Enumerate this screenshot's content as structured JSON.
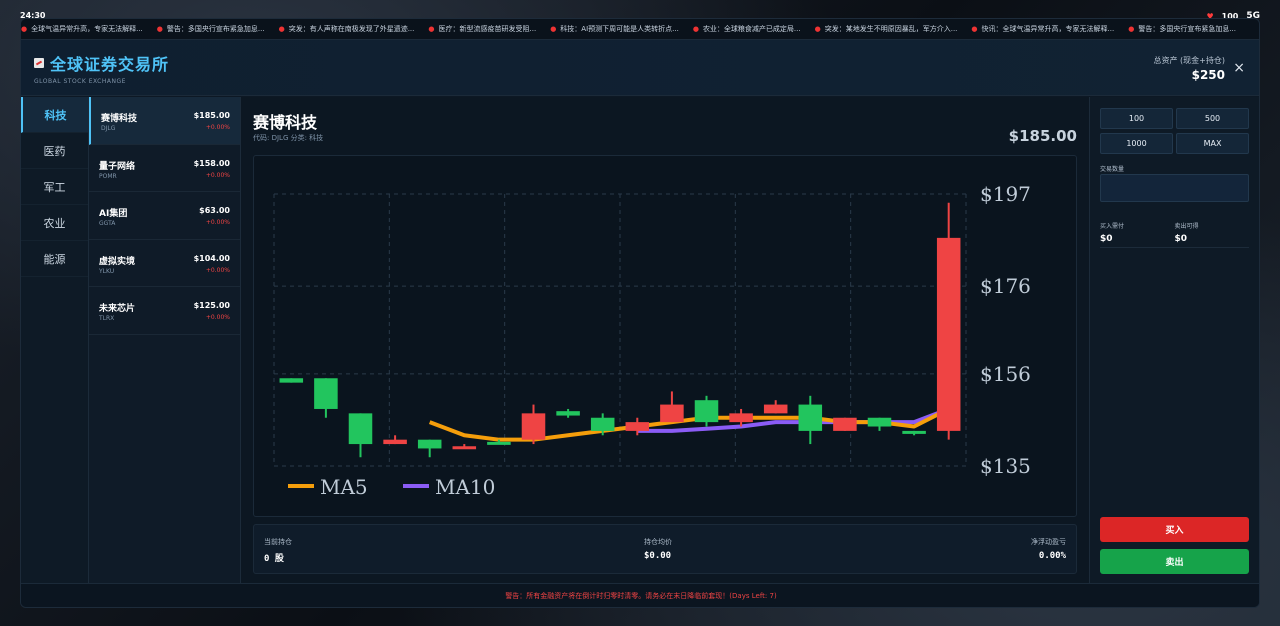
{
  "status_bar": {
    "time": "24:30",
    "health": "100",
    "network": "5G"
  },
  "ticker": [
    "全球气温异常升高，专家无法解释...",
    "警告：多国央行宣布紧急加息...",
    "突发：有人声称在南极发现了外星遗迹...",
    "医疗：新型流感疫苗研发受阻...",
    "科技：AI预测下周可能是人类转折点...",
    "农业：全球粮食减产已成定局...",
    "突发：某地发生不明原因暴乱，军方介入...",
    "快讯：全球气温异常升高，专家无法解释...",
    "警告：多国央行宣布紧急加息..."
  ],
  "header": {
    "title": "全球证券交易所",
    "subtitle": "GLOBAL STOCK EXCHANGE",
    "assets_label": "总资产 (现金+持仓)",
    "assets_value": "$250",
    "close": "×"
  },
  "categories": [
    {
      "label": "科技",
      "active": true
    },
    {
      "label": "医药",
      "active": false
    },
    {
      "label": "军工",
      "active": false
    },
    {
      "label": "农业",
      "active": false
    },
    {
      "label": "能源",
      "active": false
    }
  ],
  "stocks": [
    {
      "name": "赛博科技",
      "code": "DJLG",
      "price": "$185.00",
      "change": "+0.00%",
      "active": true
    },
    {
      "name": "量子网络",
      "code": "POMR",
      "price": "$158.00",
      "change": "+0.00%",
      "active": false
    },
    {
      "name": "AI集团",
      "code": "GGTA",
      "price": "$63.00",
      "change": "+0.00%",
      "active": false
    },
    {
      "name": "虚拟实境",
      "code": "YLKU",
      "price": "$104.00",
      "change": "+0.00%",
      "active": false
    },
    {
      "name": "未来芯片",
      "code": "TLRX",
      "price": "$125.00",
      "change": "+0.00%",
      "active": false
    }
  ],
  "selected": {
    "title": "赛博科技",
    "meta": "代码: DJLG 分类: 科技",
    "price": "$185.00"
  },
  "chart_data": {
    "type": "candlestick",
    "y_ticks": [
      "$197",
      "$176",
      "$156",
      "$135"
    ],
    "ylim": [
      135,
      197
    ],
    "grid": true,
    "legend": [
      {
        "name": "MA5",
        "color": "#f59e0b"
      },
      {
        "name": "MA10",
        "color": "#8b5cf6"
      }
    ],
    "up_color": "#ef4444",
    "down_color": "#22c55e",
    "candles": [
      {
        "o": 155,
        "c": 154,
        "h": 155,
        "l": 154
      },
      {
        "o": 155,
        "c": 148,
        "h": 155,
        "l": 146
      },
      {
        "o": 147,
        "c": 140,
        "h": 147,
        "l": 137
      },
      {
        "o": 140,
        "c": 141,
        "h": 142,
        "l": 140
      },
      {
        "o": 141,
        "c": 139,
        "h": 141,
        "l": 137
      },
      {
        "o": 139,
        "c": 139.5,
        "h": 140,
        "l": 139
      },
      {
        "o": 140.5,
        "c": 140,
        "h": 141,
        "l": 140
      },
      {
        "o": 141,
        "c": 147,
        "h": 149,
        "l": 140
      },
      {
        "o": 147.5,
        "c": 146.5,
        "h": 148,
        "l": 146
      },
      {
        "o": 146,
        "c": 143,
        "h": 147,
        "l": 142
      },
      {
        "o": 143,
        "c": 145,
        "h": 146,
        "l": 142
      },
      {
        "o": 145,
        "c": 149,
        "h": 152,
        "l": 145
      },
      {
        "o": 150,
        "c": 145,
        "h": 151,
        "l": 144
      },
      {
        "o": 145,
        "c": 147,
        "h": 148,
        "l": 144
      },
      {
        "o": 147,
        "c": 149,
        "h": 150,
        "l": 147
      },
      {
        "o": 149,
        "c": 143,
        "h": 151,
        "l": 140
      },
      {
        "o": 143,
        "c": 146,
        "h": 146,
        "l": 143
      },
      {
        "o": 146,
        "c": 144,
        "h": 146,
        "l": 143
      },
      {
        "o": 143,
        "c": 142.5,
        "h": 143,
        "l": 142
      },
      {
        "o": 143,
        "c": 187,
        "h": 195,
        "l": 141
      }
    ],
    "ma5": [
      null,
      null,
      null,
      null,
      145,
      142,
      141,
      141,
      142,
      143,
      144,
      145,
      146,
      146,
      146,
      146,
      145,
      145,
      144,
      148
    ],
    "ma10": [
      null,
      null,
      null,
      null,
      null,
      null,
      null,
      null,
      null,
      null,
      143,
      143,
      143.5,
      144,
      145,
      145,
      145,
      145,
      145,
      148
    ]
  },
  "position": {
    "holding_label": "当前持仓",
    "holding_value": "0 股",
    "avg_label": "持仓均价",
    "avg_value": "$0.00",
    "pnl_label": "净浮动盈亏",
    "pnl_value": "0.00%"
  },
  "trade": {
    "qty_buttons": [
      "100",
      "500",
      "1000",
      "MAX"
    ],
    "qty_label": "交易数量",
    "qty_value": "",
    "cost_label": "买入需付",
    "cost_value": "$0",
    "proceeds_label": "卖出可得",
    "proceeds_value": "$0",
    "buy_label": "买入",
    "sell_label": "卖出"
  },
  "footer": {
    "warning": "警告：所有金融资产将在倒计时归零时清零。请务必在末日降临前套现！(Days Left: 7)"
  }
}
